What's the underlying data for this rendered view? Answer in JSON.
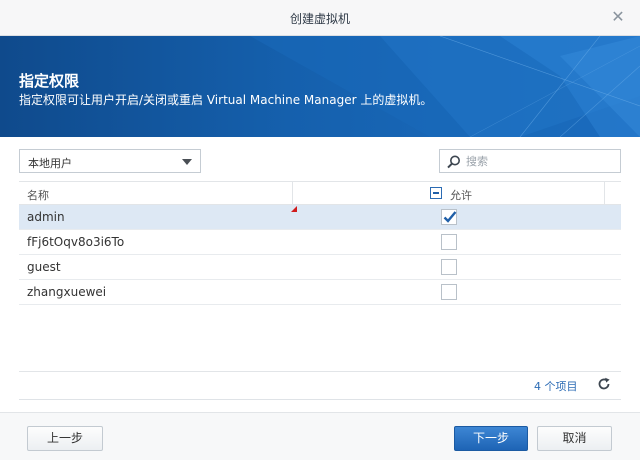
{
  "window": {
    "title": "创建虚拟机"
  },
  "banner": {
    "title": "指定权限",
    "description": "指定权限可让用户开启/关闭或重启 Virtual Machine Manager 上的虚拟机。"
  },
  "filter": {
    "selected": "本地用户"
  },
  "search": {
    "placeholder": "搜索",
    "value": ""
  },
  "grid": {
    "columns": [
      "名称",
      "允许"
    ],
    "rows": [
      {
        "name": "admin",
        "allowed": true,
        "selected": true
      },
      {
        "name": "fFj6tOqv8o3i6To",
        "allowed": false,
        "selected": false
      },
      {
        "name": "guest",
        "allowed": false,
        "selected": false
      },
      {
        "name": "zhangxuewei",
        "allowed": false,
        "selected": false
      }
    ]
  },
  "status": {
    "item_count": "4 个项目"
  },
  "footer": {
    "prev_label": "上一步",
    "next_label": "下一步",
    "cancel_label": "取消"
  },
  "colors": {
    "banner": "#1560ad",
    "primary_button": "#1e64b5",
    "selected_row": "#dde8f4"
  },
  "icons": [
    "close-icon",
    "chevron-down-icon",
    "search-icon",
    "checkbox-partial-icon",
    "checkmark-icon",
    "refresh-icon"
  ]
}
